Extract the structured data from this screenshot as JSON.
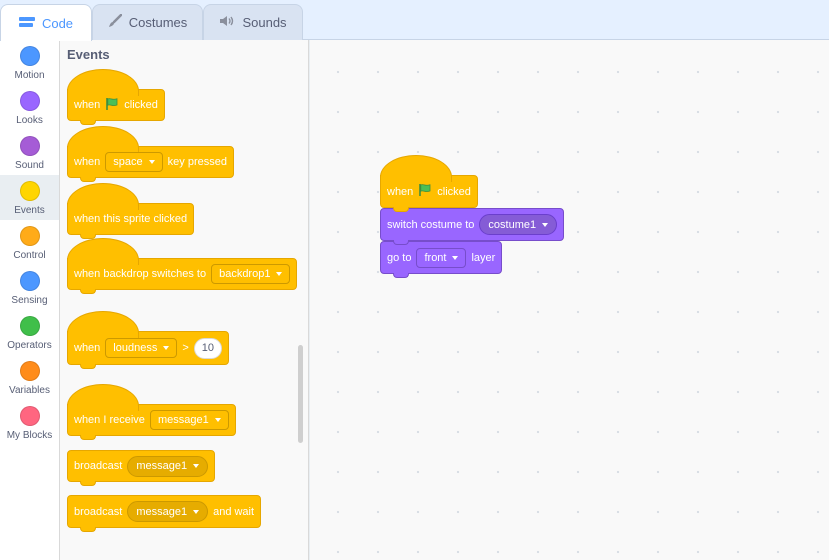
{
  "tabs": [
    {
      "label": "Code",
      "icon": "code-icon"
    },
    {
      "label": "Costumes",
      "icon": "brush-icon"
    },
    {
      "label": "Sounds",
      "icon": "speaker-icon"
    }
  ],
  "categories": [
    {
      "label": "Motion",
      "color": "#4c97ff"
    },
    {
      "label": "Looks",
      "color": "#9966ff"
    },
    {
      "label": "Sound",
      "color": "#cf63cf"
    },
    {
      "label": "Events",
      "color": "#ffbf00"
    },
    {
      "label": "Control",
      "color": "#ffab19"
    },
    {
      "label": "Sensing",
      "color": "#5cb1d6"
    },
    {
      "label": "Operators",
      "color": "#59c059"
    },
    {
      "label": "Variables",
      "color": "#ff8c1a"
    },
    {
      "label": "My Blocks",
      "color": "#ff6680"
    }
  ],
  "selected_category": "Events",
  "palette": {
    "title": "Events",
    "flag_block": {
      "when": "when",
      "clicked": "clicked"
    },
    "key_block": {
      "when": "when",
      "key": "space",
      "tail": "key pressed"
    },
    "sprite_block": {
      "label": "when this sprite clicked"
    },
    "backdrop_block": {
      "label": "when backdrop switches to",
      "value": "backdrop1"
    },
    "loudness_block": {
      "when": "when",
      "sensor": "loudness",
      "op": ">",
      "value": "10"
    },
    "receive_block": {
      "label": "when I receive",
      "value": "message1"
    },
    "broadcast_block": {
      "label": "broadcast",
      "value": "message1"
    },
    "broadcast_wait_block": {
      "label": "broadcast",
      "value": "message1",
      "tail": "and wait"
    }
  },
  "script": {
    "hat": {
      "when": "when",
      "clicked": "clicked"
    },
    "switch": {
      "label": "switch costume to",
      "value": "costume1"
    },
    "layer": {
      "go": "go to",
      "value": "front",
      "tail": "layer"
    }
  },
  "colors": {
    "events": "#ffbf00",
    "looks": "#9966ff",
    "flag": "#4cbf56",
    "accent": "#4c97ff"
  }
}
